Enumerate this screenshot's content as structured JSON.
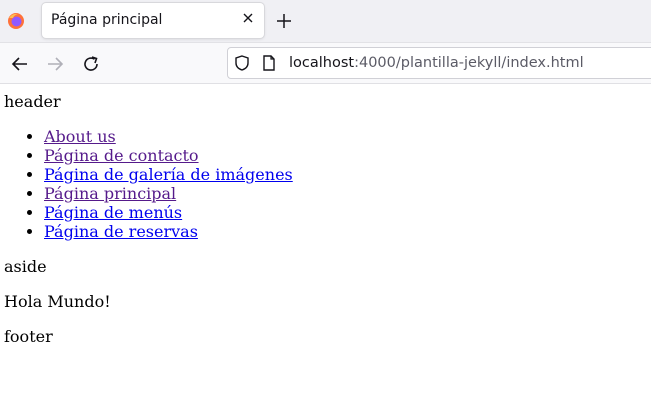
{
  "browser": {
    "tab_title": "Página principal",
    "url_host": "localhost",
    "url_rest": ":4000/plantilla-jekyll/index.html"
  },
  "page": {
    "header_text": "header",
    "nav_links": [
      {
        "label": "About us",
        "visited": true
      },
      {
        "label": "Página de contacto",
        "visited": true
      },
      {
        "label": "Página de galería de imágenes",
        "visited": false
      },
      {
        "label": "Página principal",
        "visited": true
      },
      {
        "label": "Página de menús",
        "visited": false
      },
      {
        "label": "Página de reservas",
        "visited": false
      }
    ],
    "aside_text": "aside",
    "main_text": "Hola Mundo!",
    "footer_text": "footer"
  },
  "colors": {
    "link": "#0000ee",
    "visited_link": "#551a8b"
  }
}
